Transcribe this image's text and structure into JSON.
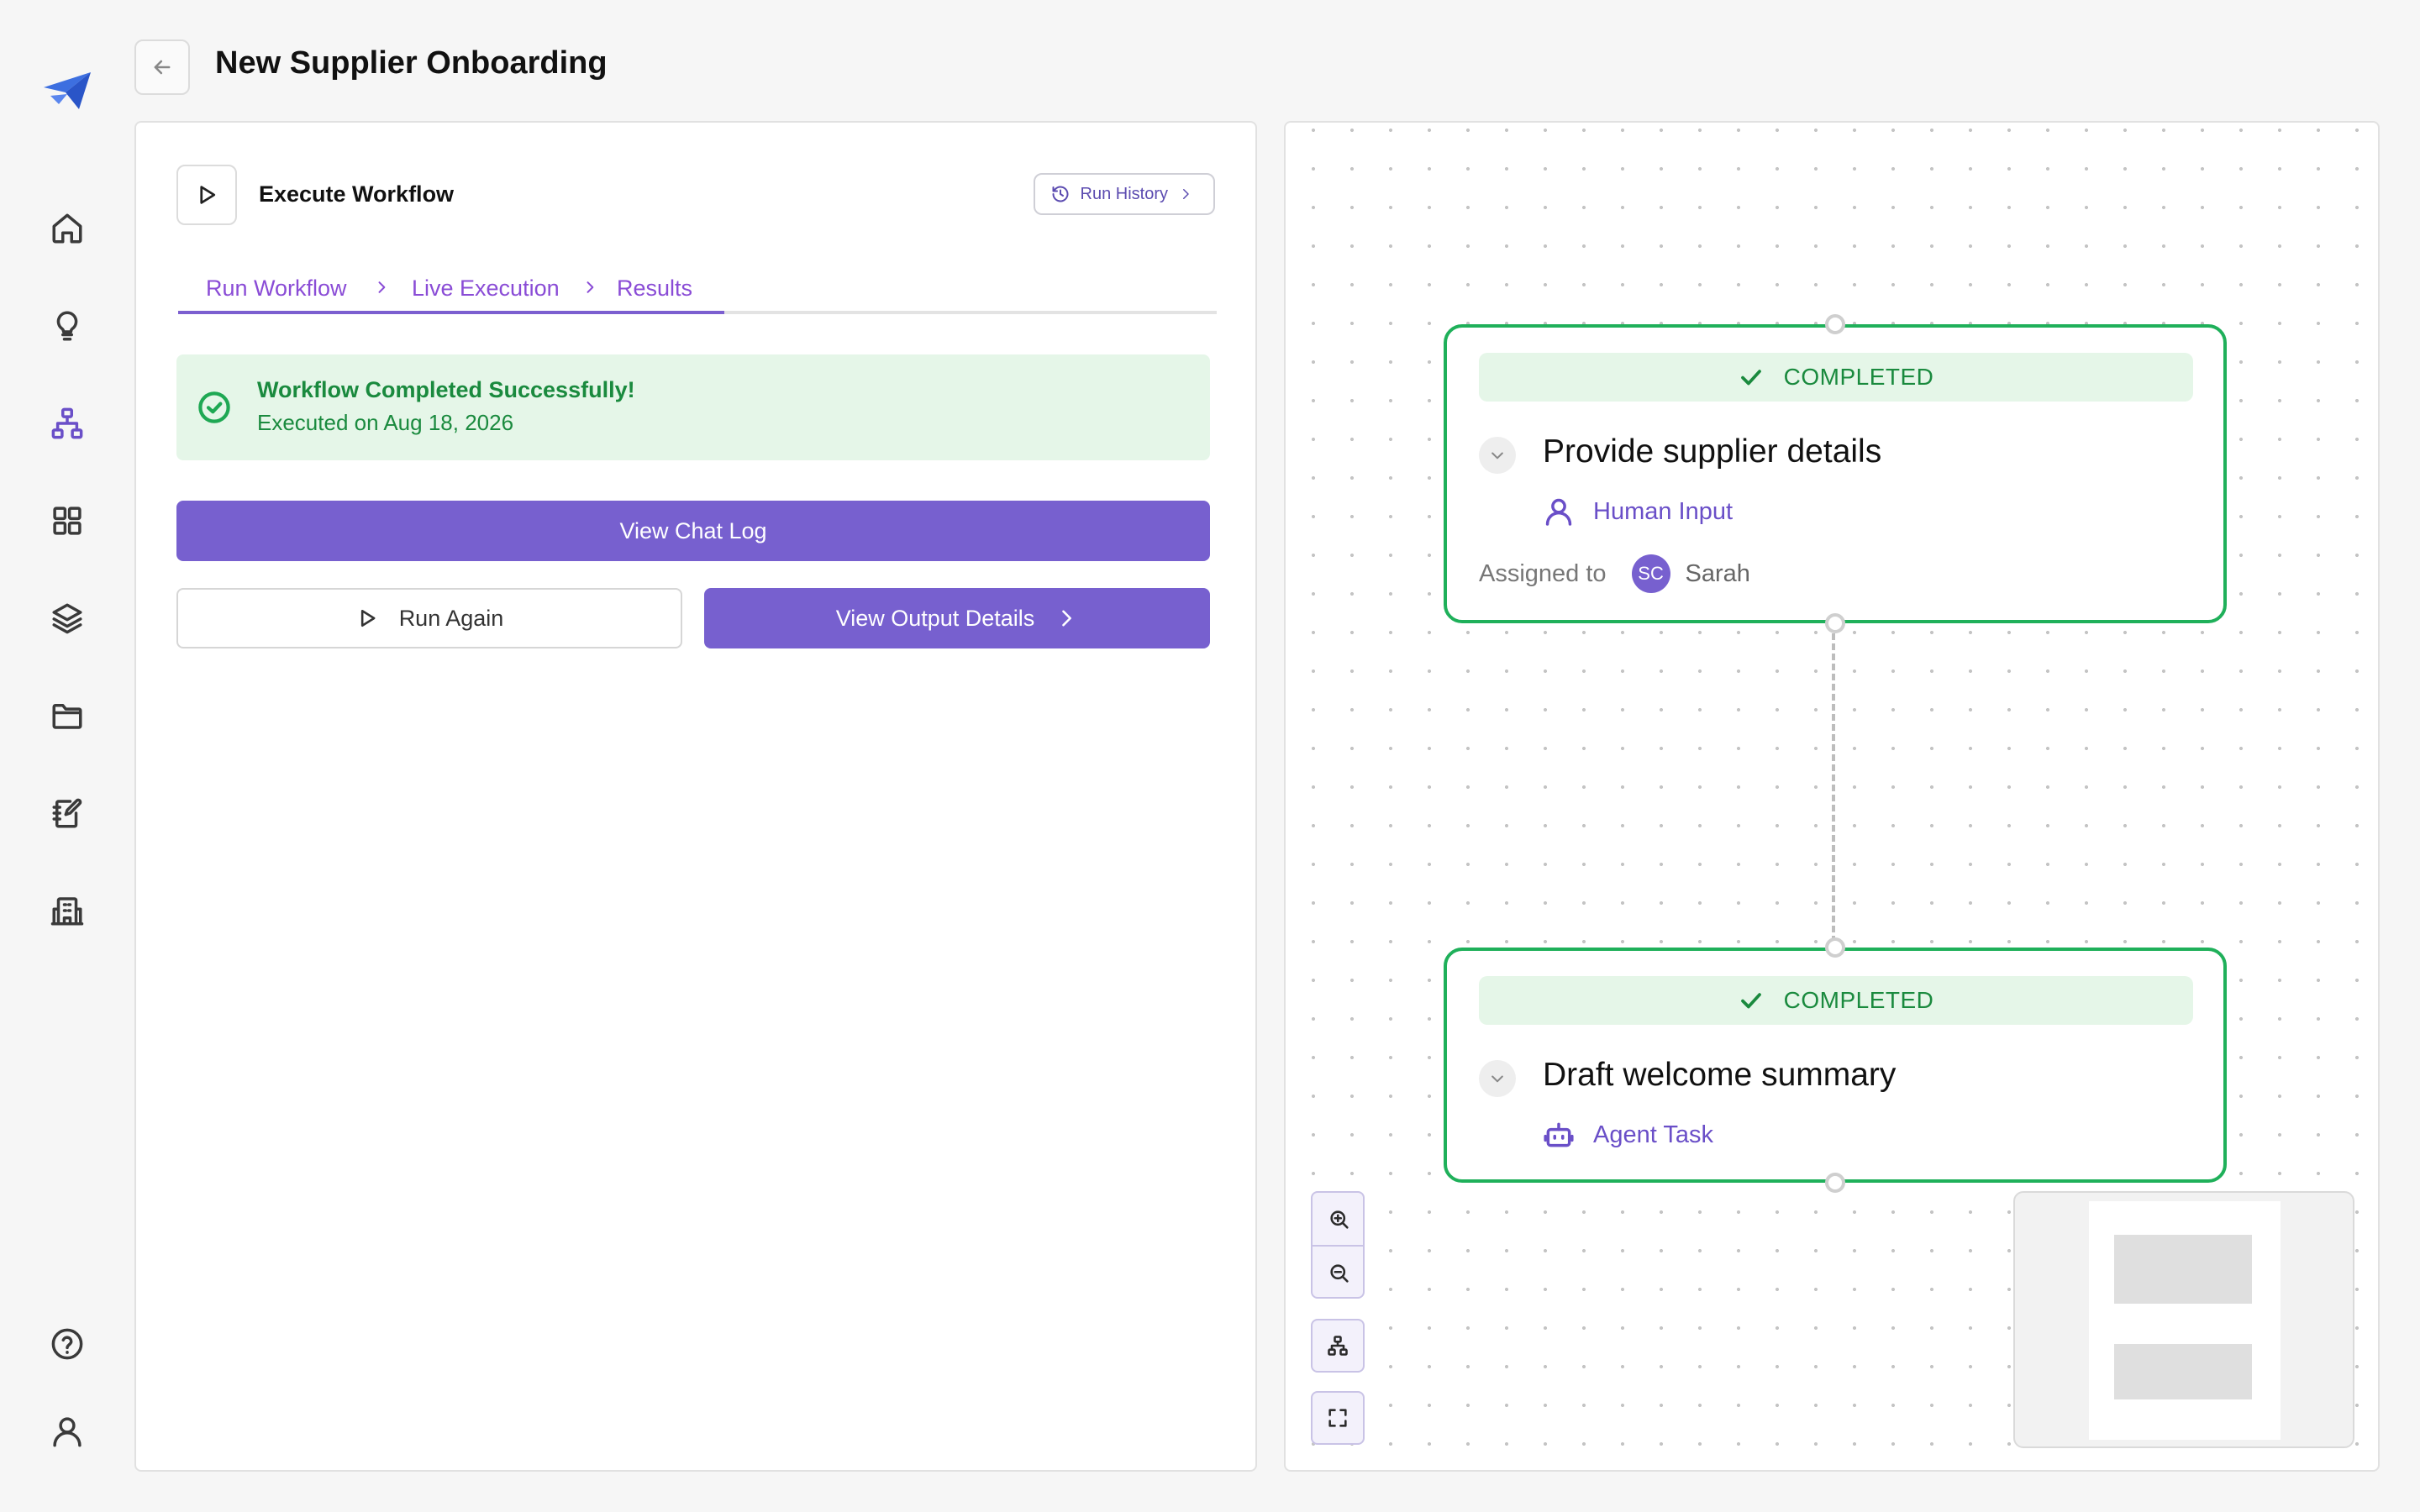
{
  "header": {
    "title": "New Supplier Onboarding"
  },
  "sidebar": {
    "items": [
      {
        "icon": "home-icon"
      },
      {
        "icon": "lightbulb-icon"
      },
      {
        "icon": "workflow-icon",
        "active": true
      },
      {
        "icon": "grid-icon"
      },
      {
        "icon": "layers-icon"
      },
      {
        "icon": "folder-icon"
      },
      {
        "icon": "notebook-edit-icon"
      },
      {
        "icon": "building-icon"
      }
    ],
    "bottom": [
      {
        "icon": "help-icon"
      },
      {
        "icon": "user-icon"
      }
    ]
  },
  "panel": {
    "title": "Execute Workflow",
    "run_history_label": "Run History",
    "steps": [
      "Run Workflow",
      "Live Execution",
      "Results"
    ],
    "success": {
      "title": "Workflow Completed Successfully!",
      "subtitle": "Executed on Aug 18, 2026"
    },
    "buttons": {
      "view_chat_log": "View Chat Log",
      "run_again": "Run Again",
      "view_output_details": "View Output Details"
    }
  },
  "canvas": {
    "nodes": [
      {
        "status": "COMPLETED",
        "title": "Provide supplier details",
        "type": "Human Input",
        "type_icon": "user-icon",
        "assigned_label": "Assigned to",
        "assignee_initials": "SC",
        "assignee_name": "Sarah"
      },
      {
        "status": "COMPLETED",
        "title": "Draft welcome summary",
        "type": "Agent Task",
        "type_icon": "bot-icon"
      }
    ],
    "controls": [
      "zoom-in-icon",
      "zoom-out-icon",
      "auto-layout-icon",
      "fit-view-icon"
    ]
  },
  "colors": {
    "accent": "#7760cf",
    "success": "#1fb05a",
    "success_bg": "#e5f6e8",
    "step_text": "#8a4cd6"
  }
}
